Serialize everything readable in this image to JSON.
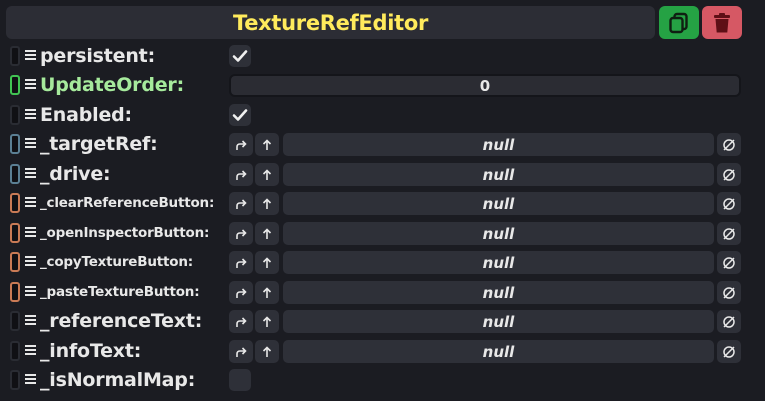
{
  "header": {
    "title": "TextureRefEditor",
    "title_color": "#ffeb5c",
    "duplicate_icon": "duplicate-icon",
    "delete_icon": "trash-icon"
  },
  "rows": [
    {
      "label": "persistent:",
      "kind": "checkbox",
      "checked": true,
      "accent": "#2a2c33"
    },
    {
      "label": "UpdateOrder:",
      "kind": "number",
      "value": "0",
      "accent": "#41c353"
    },
    {
      "label": "Enabled:",
      "kind": "checkbox",
      "checked": true,
      "accent": "#2a2c33"
    },
    {
      "label": "_targetRef:",
      "kind": "ref",
      "value": "null",
      "accent": "#5b7f93"
    },
    {
      "label": "_drive:",
      "kind": "ref",
      "value": "null",
      "accent": "#5b7f93"
    },
    {
      "label": "_clearReferenceButton:",
      "kind": "ref",
      "value": "null",
      "accent": "#c97a55"
    },
    {
      "label": "_openInspectorButton:",
      "kind": "ref",
      "value": "null",
      "accent": "#c97a55"
    },
    {
      "label": "_copyTextureButton:",
      "kind": "ref",
      "value": "null",
      "accent": "#c97a55"
    },
    {
      "label": "_pasteTextureButton:",
      "kind": "ref",
      "value": "null",
      "accent": "#c97a55"
    },
    {
      "label": "_referenceText:",
      "kind": "ref",
      "value": "null",
      "accent": "#2a2c33"
    },
    {
      "label": "_infoText:",
      "kind": "ref",
      "value": "null",
      "accent": "#2a2c33"
    },
    {
      "label": "_isNormalMap:",
      "kind": "checkbox",
      "checked": false,
      "accent": "#2a2c33"
    }
  ]
}
